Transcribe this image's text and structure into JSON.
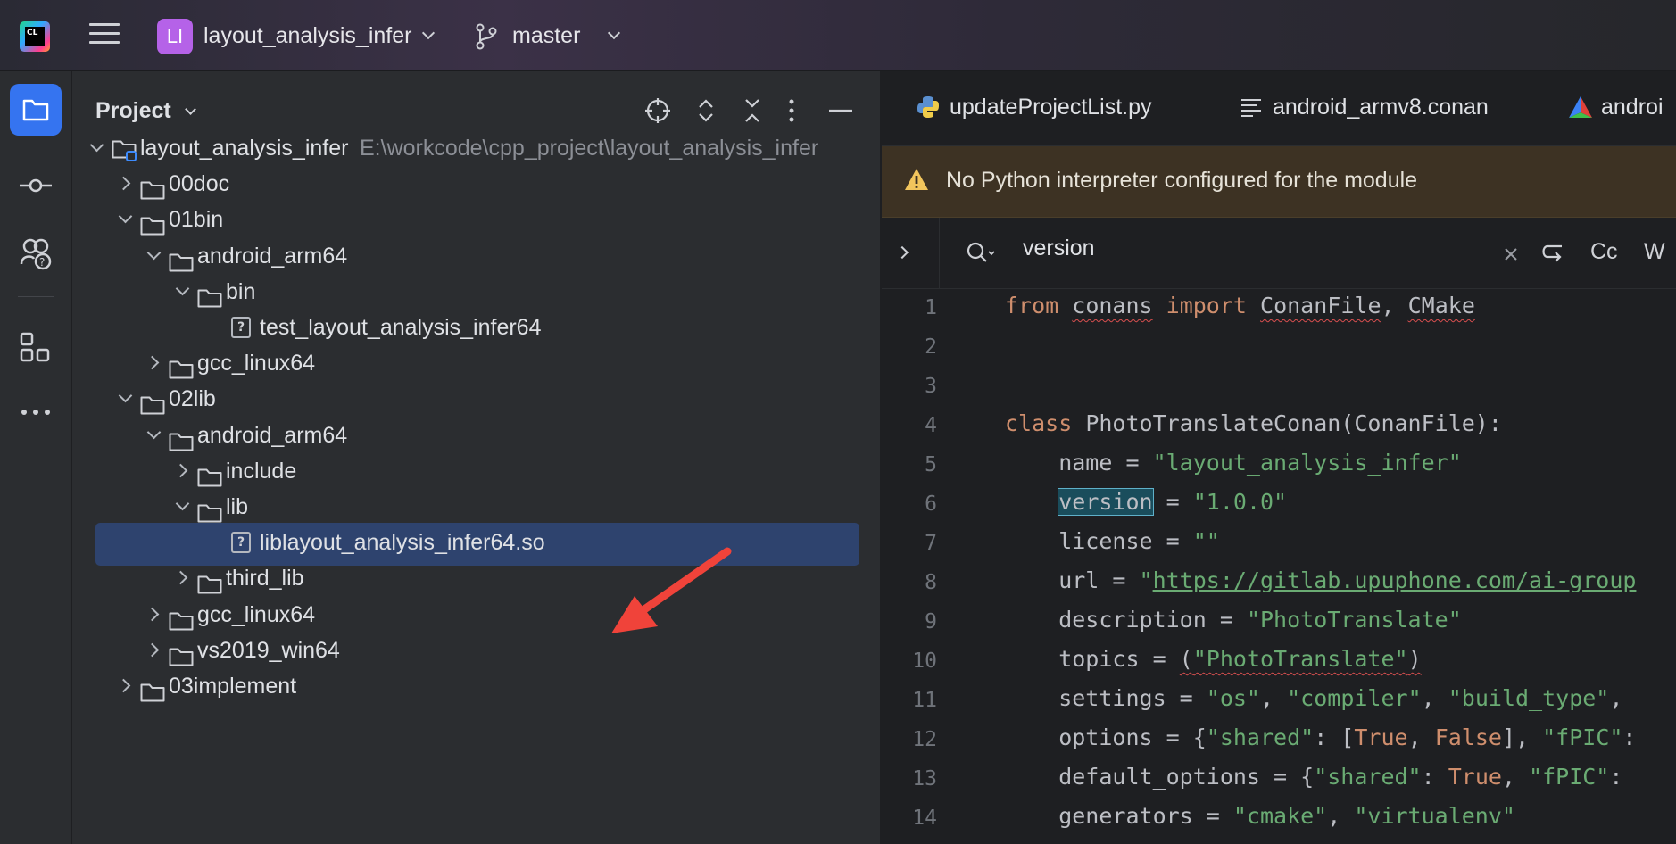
{
  "topbar": {
    "app_logo_text": "CL",
    "project_badge": "LI",
    "project_name": "layout_analysis_infer",
    "branch_name": "master"
  },
  "panel": {
    "title": "Project",
    "tree": [
      {
        "label": "layout_analysis_infer",
        "path": "E:\\workcode\\cpp_project\\layout_analysis_infer",
        "depth": 0,
        "state": "open",
        "kind": "module"
      },
      {
        "label": "00doc",
        "depth": 1,
        "state": "closed",
        "kind": "folder"
      },
      {
        "label": "01bin",
        "depth": 1,
        "state": "open",
        "kind": "folder"
      },
      {
        "label": "android_arm64",
        "depth": 2,
        "state": "open",
        "kind": "folder"
      },
      {
        "label": "bin",
        "depth": 3,
        "state": "open",
        "kind": "folder"
      },
      {
        "label": "test_layout_analysis_infer64",
        "depth": 4,
        "state": "none",
        "kind": "file"
      },
      {
        "label": "gcc_linux64",
        "depth": 2,
        "state": "closed",
        "kind": "folder"
      },
      {
        "label": "02lib",
        "depth": 1,
        "state": "open",
        "kind": "folder"
      },
      {
        "label": "android_arm64",
        "depth": 2,
        "state": "open",
        "kind": "folder"
      },
      {
        "label": "include",
        "depth": 3,
        "state": "closed",
        "kind": "folder"
      },
      {
        "label": "lib",
        "depth": 3,
        "state": "open",
        "kind": "folder"
      },
      {
        "label": "liblayout_analysis_infer64.so",
        "depth": 4,
        "state": "none",
        "kind": "file",
        "selected": true
      },
      {
        "label": "third_lib",
        "depth": 3,
        "state": "closed",
        "kind": "folder"
      },
      {
        "label": "gcc_linux64",
        "depth": 2,
        "state": "closed",
        "kind": "folder"
      },
      {
        "label": "vs2019_win64",
        "depth": 2,
        "state": "closed",
        "kind": "folder"
      },
      {
        "label": "03implement",
        "depth": 1,
        "state": "closed",
        "kind": "folder"
      }
    ]
  },
  "editor": {
    "tabs": [
      {
        "label": "updateProjectList.py",
        "icon": "python-icon"
      },
      {
        "label": "android_armv8.conan",
        "icon": "text-file-icon"
      },
      {
        "label": "androi",
        "icon": "cmake-icon"
      }
    ],
    "warning": "No Python interpreter configured for the module",
    "search": {
      "value": "version",
      "case_label": "Cc",
      "word_label": "W"
    },
    "line_numbers": [
      "1",
      "2",
      "3",
      "4",
      "5",
      "6",
      "7",
      "8",
      "9",
      "10",
      "11",
      "12",
      "13",
      "14"
    ],
    "code": [
      "from conans import ConanFile, CMake",
      "",
      "",
      "class PhotoTranslateConan(ConanFile):",
      "    name = \"layout_analysis_infer\"",
      "    version = \"1.0.0\"",
      "    license = \"\"",
      "    url = \"https://gitlab.upuphone.com/ai-group",
      "    description = \"PhotoTranslate\"",
      "    topics = (\"PhotoTranslate\")",
      "    settings = \"os\", \"compiler\", \"build_type\",",
      "    options = {\"shared\": [True, False], \"fPIC\":",
      "    default_options = {\"shared\": True, \"fPIC\":",
      "    generators = \"cmake\", \"virtualenv\""
    ]
  },
  "colors": {
    "accent": "#3574f0",
    "selection": "#2e436e",
    "keyword": "#cf8e6d",
    "string": "#6aab73",
    "warning_bg": "#3d3223",
    "arrow": "#f0433a"
  }
}
